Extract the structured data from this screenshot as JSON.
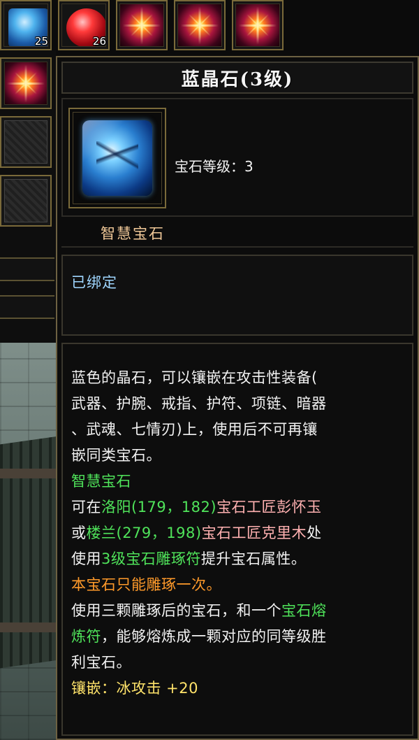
{
  "top_slots": [
    {
      "icon": "blue-crystal-gem-icon",
      "count": "25"
    },
    {
      "icon": "red-crystal-gem-icon",
      "count": "26"
    },
    {
      "icon": "spark-gem-icon",
      "count": ""
    },
    {
      "icon": "spark-gem-icon",
      "count": ""
    },
    {
      "icon": "spark-gem-icon",
      "count": ""
    }
  ],
  "side_slots": [
    {
      "icon": "spark-gem-icon"
    },
    {
      "icon": "empty-slot-icon"
    },
    {
      "icon": "empty-slot-icon"
    }
  ],
  "tooltip": {
    "title": "蓝晶石(3级)",
    "level_label": "宝石等级：3",
    "gem_type": "智慧宝石",
    "bound_status": "已绑定",
    "description": {
      "l1": "蓝色的晶石，可以镶嵌在攻击性装备(",
      "l2": "武器、护腕、戒指、护符、项链、暗器",
      "l3": "、武魂、七情刃)上，使用后不可再镶",
      "l4": "嵌同类宝石。",
      "l5": "智慧宝石",
      "l6_a": "可在",
      "l6_b": "洛阳(179，182)",
      "l6_c": "宝石工匠彭怀玉",
      "l7_a": "或",
      "l7_b": "楼兰(279，198)",
      "l7_c": "宝石工匠克里木",
      "l7_d": "处",
      "l8_a": "使用",
      "l8_b": "3级宝石雕琢符",
      "l8_c": "提升宝石属性。",
      "l9": "本宝石只能雕琢一次。",
      "l10_a": "使用三颗雕琢后的宝石，和一个",
      "l10_b": "宝石熔",
      "l11_a": "炼符",
      "l11_b": "，能够熔炼成一颗对应的同等级胜",
      "l12": "利宝石。",
      "l13_a": "镶嵌：",
      "l13_b": "冰攻击 +20"
    }
  },
  "colors": {
    "frame_gold": "#7a6a3a",
    "gem_type": "#f0c898",
    "bound": "#9fd6ff",
    "green": "#4fe35a",
    "pink": "#ffb1b1",
    "orange": "#ff9a2a",
    "yellow": "#ffe36a"
  }
}
